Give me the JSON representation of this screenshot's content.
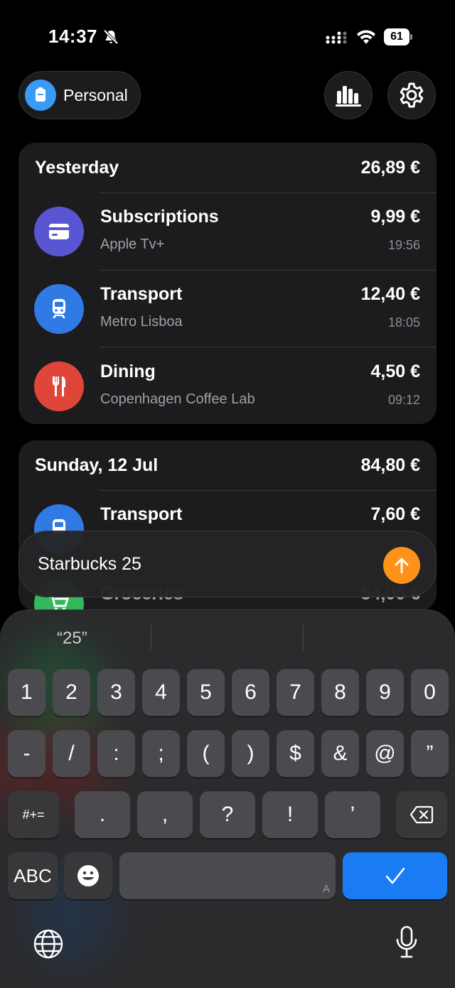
{
  "status": {
    "time": "14:37",
    "battery": "61"
  },
  "header": {
    "account_label": "Personal"
  },
  "groups": [
    {
      "title": "Yesterday",
      "total": "26,89 €",
      "items": [
        {
          "category": "Subscriptions",
          "merchant": "Apple Tv+",
          "amount": "9,99 €",
          "time": "19:56",
          "color": "#5a55d2",
          "icon": "credit-card-icon"
        },
        {
          "category": "Transport",
          "merchant": "Metro Lisboa",
          "amount": "12,40 €",
          "time": "18:05",
          "color": "#2f7ae5",
          "icon": "train-icon"
        },
        {
          "category": "Dining",
          "merchant": "Copenhagen Coffee Lab",
          "amount": "4,50 €",
          "time": "09:12",
          "color": "#e0453a",
          "icon": "fork-knife-icon"
        }
      ]
    },
    {
      "title": "Sunday, 12 Jul",
      "total": "84,80 €",
      "items": [
        {
          "category": "Transport",
          "amount": "7,60 €",
          "color": "#2f7ae5",
          "icon": "train-icon"
        },
        {
          "category": "Groceries",
          "amount": "54,00 €",
          "color": "#34b85a",
          "icon": "cart-icon"
        }
      ]
    }
  ],
  "input": {
    "text": "Starbucks 25"
  },
  "keyboard": {
    "suggestion": "“25”",
    "row1": [
      "1",
      "2",
      "3",
      "4",
      "5",
      "6",
      "7",
      "8",
      "9",
      "0"
    ],
    "row2": [
      "-",
      "/",
      ":",
      ";",
      "(",
      ")",
      "$",
      "&",
      "@",
      "”"
    ],
    "row3_mode": "#+=",
    "row3": [
      ".",
      ",",
      "?",
      "!",
      "’"
    ],
    "abc_label": "ABC",
    "space_corner": "A"
  }
}
